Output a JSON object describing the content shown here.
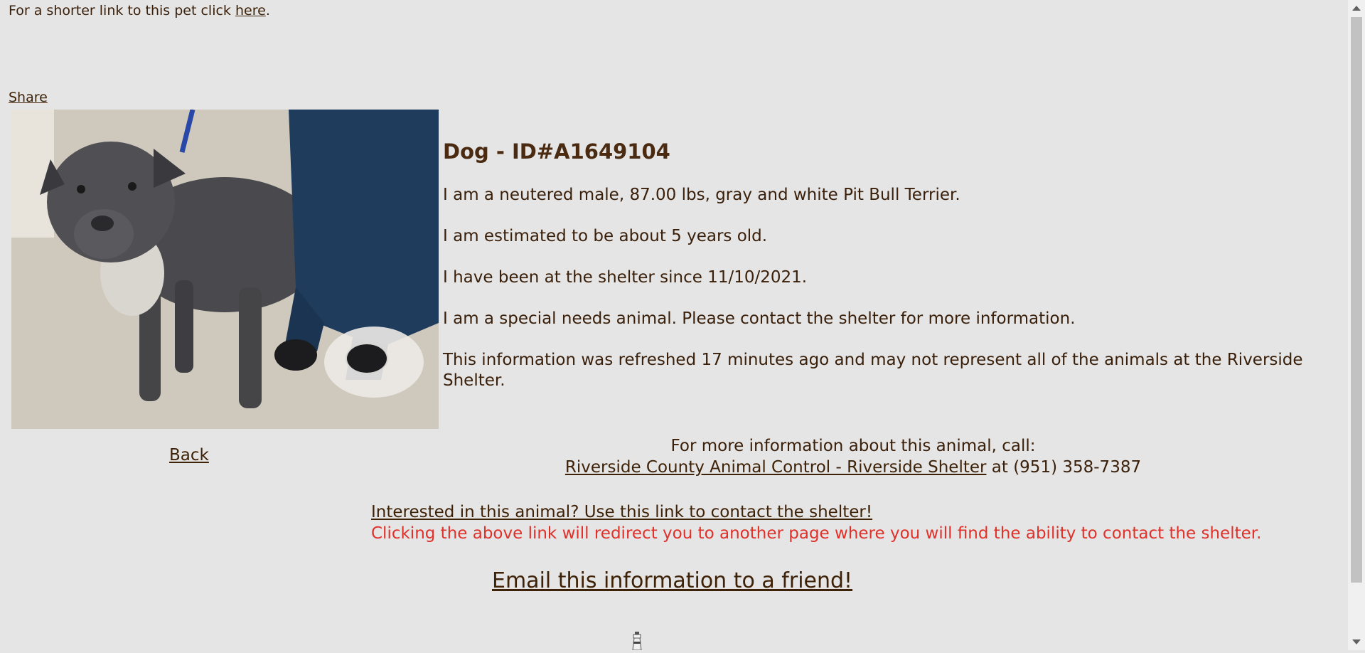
{
  "header": {
    "short_link_prefix": "For a shorter link to this pet click ",
    "short_link_text": "here",
    "short_link_suffix": ".",
    "share_label": "Share"
  },
  "pet": {
    "title": "Dog - ID#A1649104",
    "description": "I am a neutered male, 87.00 lbs, gray and white Pit Bull Terrier.",
    "age": "I am estimated to be about 5 years old.",
    "since": "I have been at the shelter since 11/10/2021.",
    "special_needs": "I am a special needs animal. Please contact the shelter for more information.",
    "refresh_note": "This information was refreshed 17 minutes ago and may not represent all of the animals at the Riverside Shelter."
  },
  "navigation": {
    "back_label": "Back"
  },
  "contact": {
    "call_intro": "For more information about this animal, call:",
    "shelter_link": "Riverside County Animal Control - Riverside Shelter",
    "phone_text": " at (951) 358-7387",
    "interest_link": "Interested in this animal? Use this link to contact the shelter!",
    "redirect_note": "Clicking the above link will redirect you to another page where you will find the ability to contact the shelter.",
    "email_link": "Email this information to a friend!"
  },
  "colors": {
    "background": "#e5e5e5",
    "text": "#3a200a",
    "link": "#3e2208",
    "warning": "#e0302a"
  },
  "icons": {
    "loader": "lighthouse-icon"
  }
}
